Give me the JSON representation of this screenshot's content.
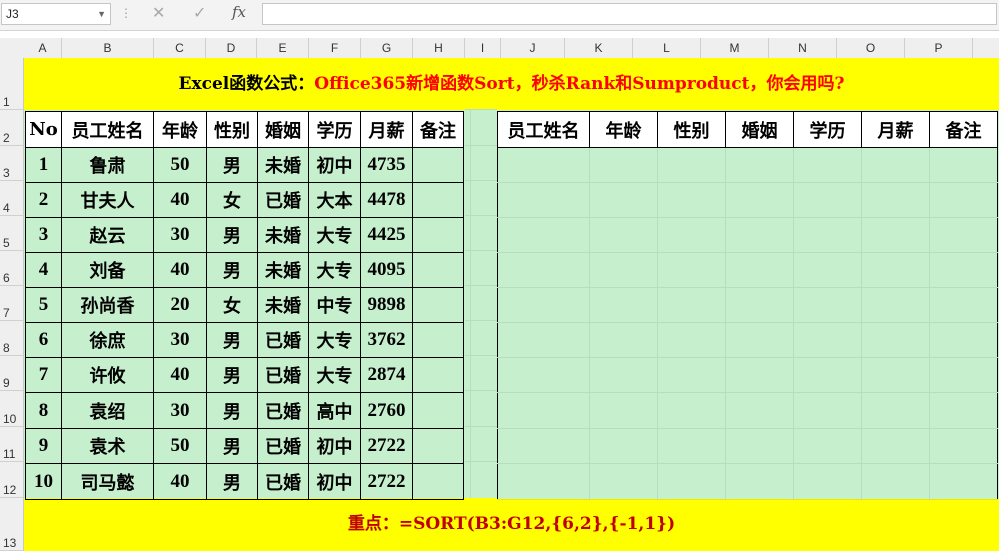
{
  "name_box": "J3",
  "formula": "",
  "toolbar_icons": [
    "cancel-icon",
    "confirm-icon",
    "fx-icon"
  ],
  "fx_label": "fx",
  "columns": [
    "A",
    "B",
    "C",
    "D",
    "E",
    "F",
    "G",
    "H",
    "I",
    "J",
    "K",
    "L",
    "M",
    "N",
    "O",
    "P"
  ],
  "rows": [
    "1",
    "2",
    "3",
    "4",
    "5",
    "6",
    "7",
    "8",
    "9",
    "10",
    "11",
    "12",
    "13"
  ],
  "title_black": "Excel函数公式：",
  "title_red": "Office365新增函数Sort，秒杀Rank和Sumproduct，你会用吗?",
  "headers": [
    "No",
    "员工姓名",
    "年龄",
    "性别",
    "婚姻",
    "学历",
    "月薪",
    "备注"
  ],
  "target_headers": [
    "员工姓名",
    "年龄",
    "性别",
    "婚姻",
    "学历",
    "月薪",
    "备注"
  ],
  "data": [
    [
      "1",
      "鲁肃",
      "50",
      "男",
      "未婚",
      "初中",
      "4735",
      ""
    ],
    [
      "2",
      "甘夫人",
      "40",
      "女",
      "已婚",
      "大本",
      "4478",
      ""
    ],
    [
      "3",
      "赵云",
      "30",
      "男",
      "未婚",
      "大专",
      "4425",
      ""
    ],
    [
      "4",
      "刘备",
      "40",
      "男",
      "未婚",
      "大专",
      "4095",
      ""
    ],
    [
      "5",
      "孙尚香",
      "20",
      "女",
      "未婚",
      "中专",
      "9898",
      ""
    ],
    [
      "6",
      "徐庶",
      "30",
      "男",
      "已婚",
      "大专",
      "3762",
      ""
    ],
    [
      "7",
      "许攸",
      "40",
      "男",
      "已婚",
      "大专",
      "2874",
      ""
    ],
    [
      "8",
      "袁绍",
      "30",
      "男",
      "已婚",
      "高中",
      "2760",
      ""
    ],
    [
      "9",
      "袁术",
      "50",
      "男",
      "已婚",
      "初中",
      "2722",
      ""
    ],
    [
      "10",
      "司马懿",
      "40",
      "男",
      "已婚",
      "初中",
      "2722",
      ""
    ]
  ],
  "footer": "重点：=SORT(B3:G12,{6,2},{-1,1})",
  "colors": {
    "yellow": "#ffff00",
    "green": "#c6efce",
    "red": "#ff0000",
    "dark_red": "#c00000"
  }
}
